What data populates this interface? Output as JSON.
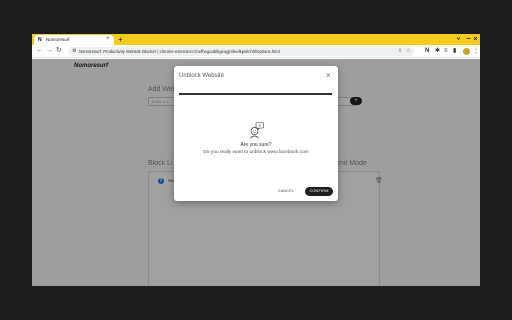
{
  "browser": {
    "tab": {
      "favicon": "N",
      "title": "Nomoresurf",
      "close_glyph": "×"
    },
    "new_tab_glyph": "+",
    "back_glyph": "←",
    "forward_glyph": "→",
    "reload_glyph": "↻",
    "address_bar": {
      "site_icon": "⚙",
      "url": "Nomoresurf: Productivity Website Blocker  |  chrome-extension://oefhegoablkgeogjmfeelkpeilchhl/options.html"
    },
    "icons": {
      "share": "⇪",
      "bookmark": "☆",
      "extension_n": "N",
      "puzzle": "✱",
      "reading_list": "≡",
      "side_panel": "▮",
      "menu": "⋮"
    },
    "accent_color": "#f5cc1d"
  },
  "page": {
    "logo": "Nomoresurf",
    "add_section_label": "Add Web",
    "add_input_placeholder": "Enter a w",
    "add_button": "+",
    "block_list_label": "Block Li",
    "mode_label": "mit Mode",
    "block_list": [
      {
        "favicon": "f",
        "text": "ww",
        "delete_glyph": "🗑"
      }
    ]
  },
  "modal": {
    "title": "Unblock Website",
    "close_glyph": "×",
    "icon": "confused-person-icon",
    "question": "Are you sure?",
    "message": "Do you really want to unblock www.facebook.com",
    "cancel_label": "CANCEL",
    "confirm_label": "CONFIRM"
  }
}
